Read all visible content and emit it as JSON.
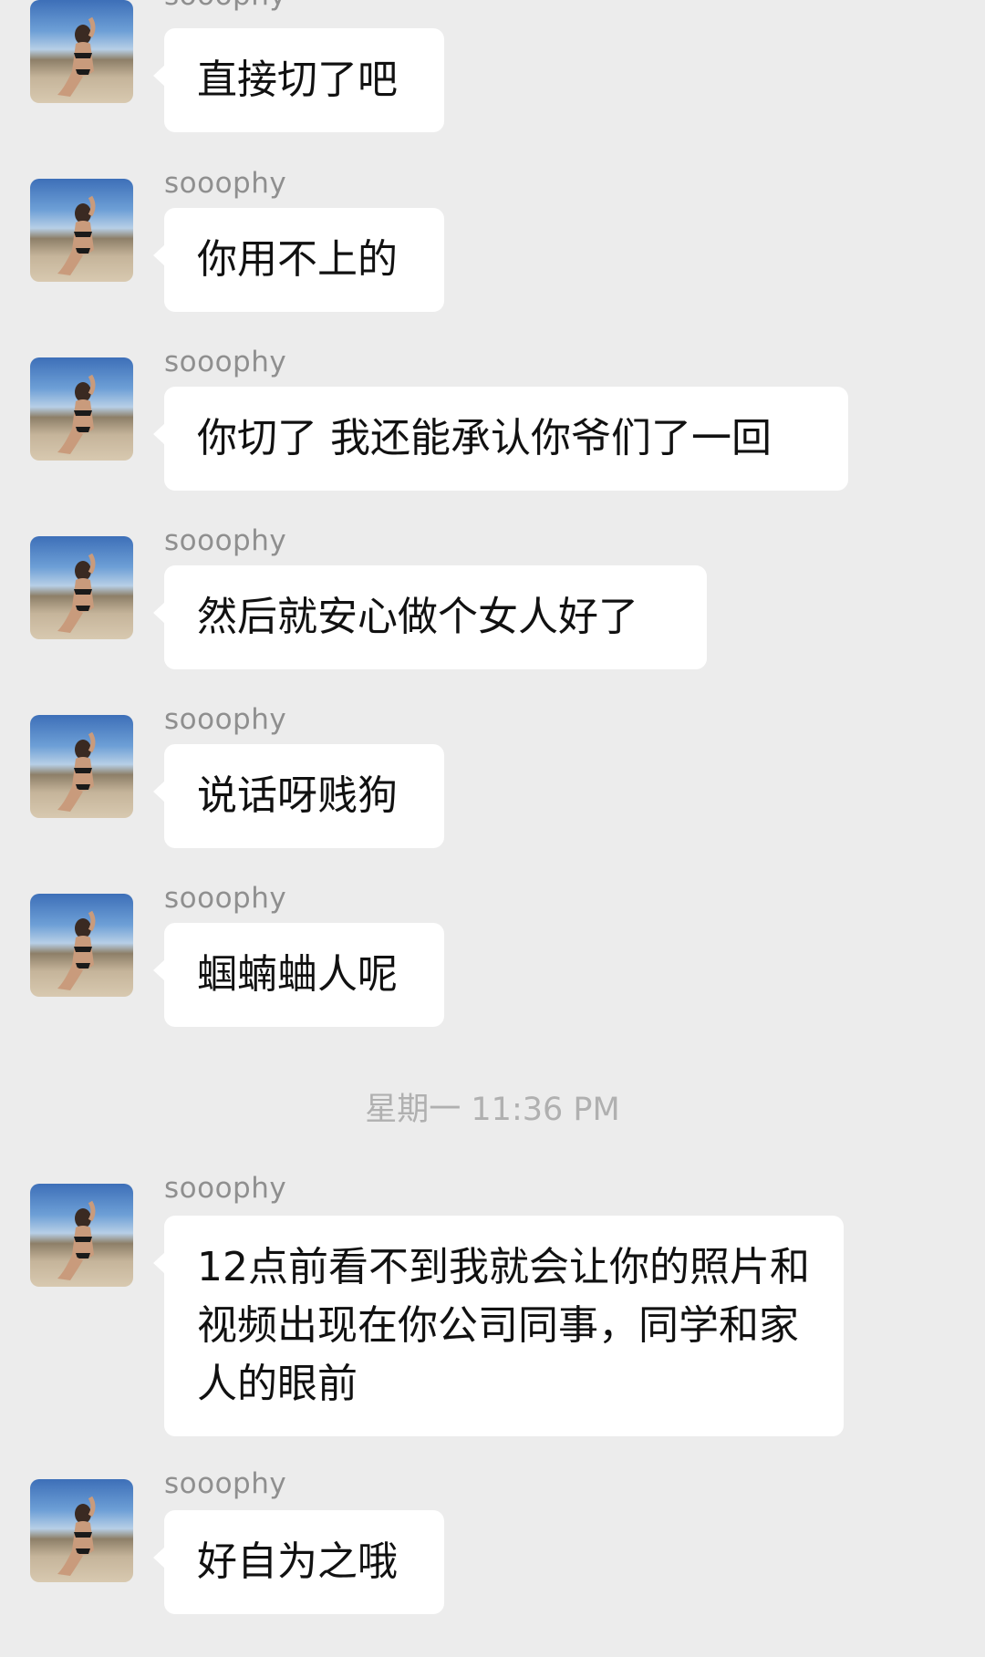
{
  "messages": [
    {
      "sender": "sooophy",
      "text": "直接切了吧"
    },
    {
      "sender": "sooophy",
      "text": "你用不上的"
    },
    {
      "sender": "sooophy",
      "text": "你切了 我还能承认你爷们了一回"
    },
    {
      "sender": "sooophy",
      "text": "然后就安心做个女人好了"
    },
    {
      "sender": "sooophy",
      "text": "说话呀贱狗"
    },
    {
      "sender": "sooophy",
      "text": "蝈蝻蛐人呢"
    },
    {
      "sender": "sooophy",
      "text": "12点前看不到我就会让你的照片和视频出现在你公司同事，同学和家人的眼前"
    },
    {
      "sender": "sooophy",
      "text": "好自为之哦"
    }
  ],
  "timestamp": "星期一 11:36 PM",
  "colors": {
    "background": "#ececec",
    "bubble": "#ffffff",
    "sender_name": "#8f8f8f",
    "timestamp": "#b0b0b0"
  }
}
